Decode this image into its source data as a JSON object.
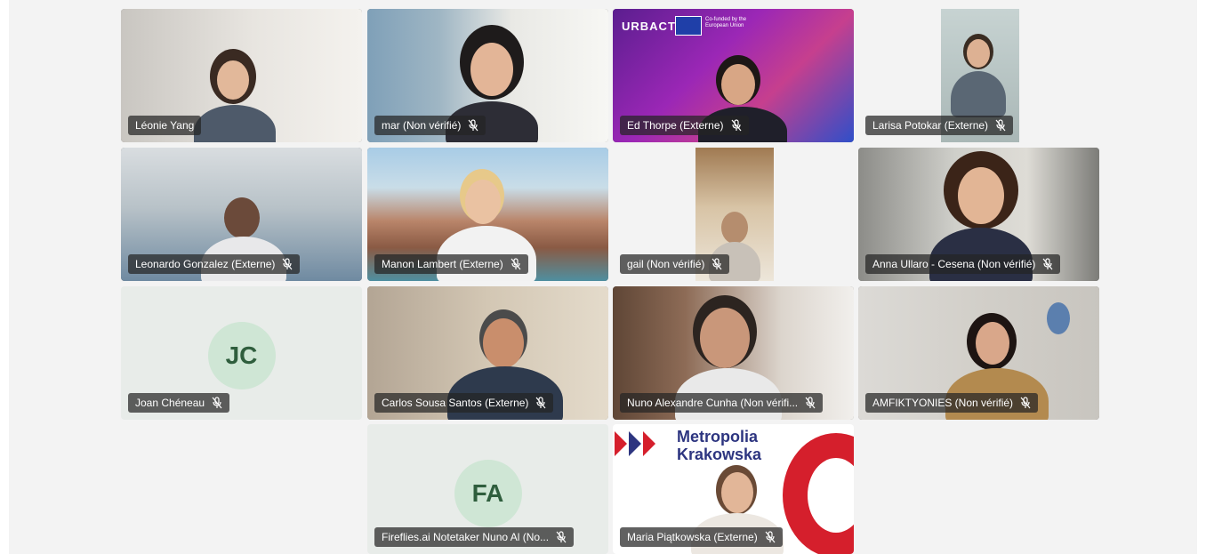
{
  "participants": [
    {
      "name": "Léonie Yang"
    },
    {
      "name": "mar (Non vérifié)"
    },
    {
      "name": "Ed Thorpe (Externe)"
    },
    {
      "name": "Larisa Potokar (Externe)"
    },
    {
      "name": "Leonardo Gonzalez (Externe)"
    },
    {
      "name": "Manon Lambert (Externe)"
    },
    {
      "name": "gail (Non vérifié)"
    },
    {
      "name": "Anna Ullaro - Cesena (Non vérifié)"
    },
    {
      "name": "Joan Chéneau",
      "initials": "JC"
    },
    {
      "name": "Carlos Sousa Santos (Externe)"
    },
    {
      "name": "Nuno Alexandre Cunha (Non vérifi..."
    },
    {
      "name": "AMFIKTYONIES (Non vérifié)"
    },
    {
      "name": "Fireflies.ai Notetaker Nuno Al (No...",
      "initials": "FA"
    },
    {
      "name": "Maria Piątkowska (Externe)"
    }
  ],
  "backgrounds": {
    "urbact": {
      "logo": "URBACT",
      "eu_text": "Co-funded by the European Union"
    },
    "krakow": {
      "line1": "Metropolia",
      "line2": "Krakowska"
    }
  },
  "icons": {
    "mic": "mic-off-icon"
  },
  "colors": {
    "label_bg": "#242424",
    "avatar_bg": "#cfe6d5",
    "avatar_text": "#2f5e3d",
    "urbact_purple": "#8a1fbf",
    "krakow_red": "#d51f2c",
    "krakow_blue": "#2d3580"
  }
}
